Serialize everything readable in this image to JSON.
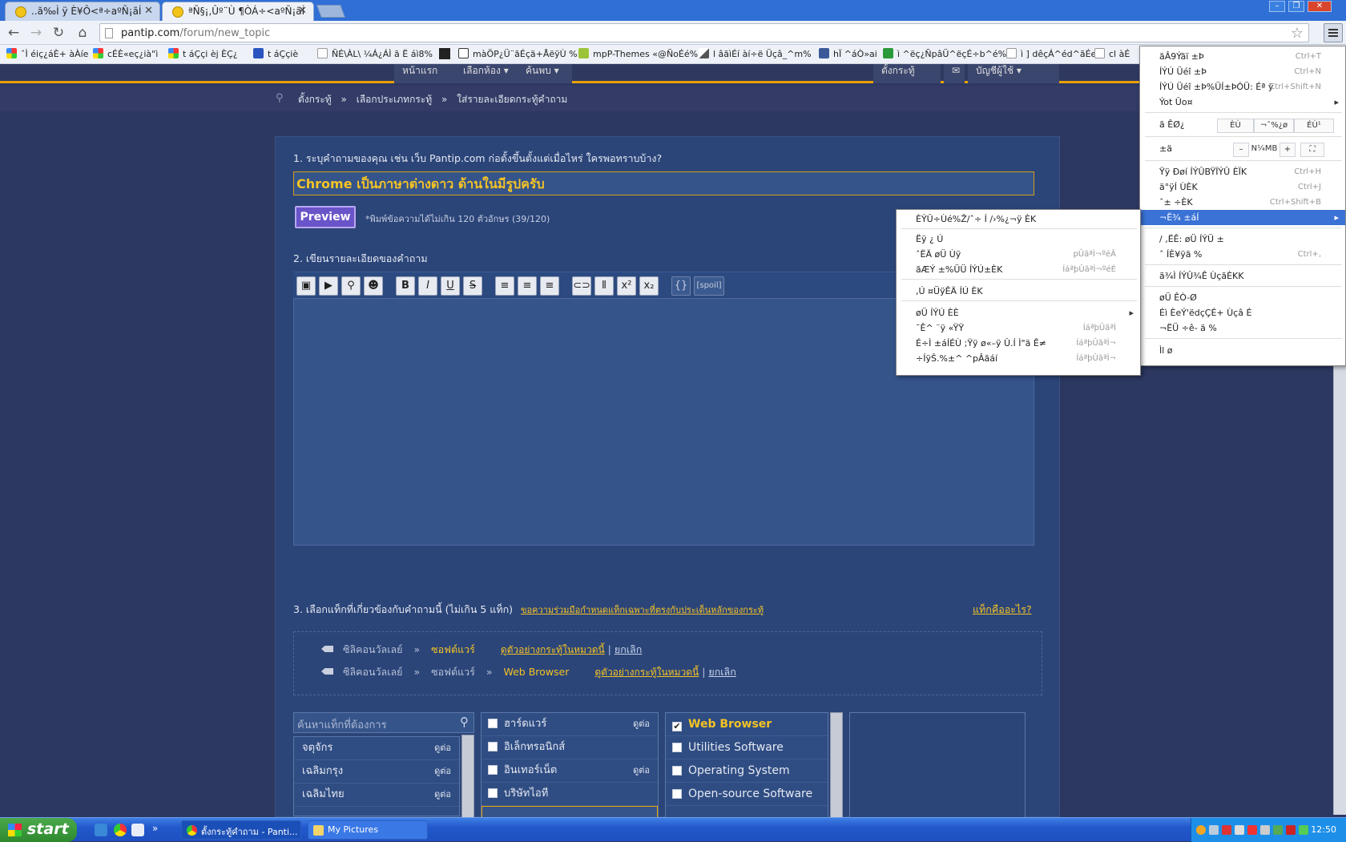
{
  "browser": {
    "tabs": [
      {
        "label": "..ã‰Ì ÿ È¥Ô<ª÷aºÑ¡ãÍ"
      },
      {
        "label": "ªÑ§¡,Ûº¨Ù ¶ÒÁ÷<aºÑ¡ãÍ"
      }
    ],
    "url_domain": "pantip.com",
    "url_path": "/forum/new_topic",
    "bookmarks": [
      "ˆÌ éiç¿áÈ+ àÀíe",
      "cÉÈ«eç¿ià\"ì",
      "t áÇçi èj ÈÇ¿",
      "t áÇçiè",
      "ÑÉ\\ÀL\\ ¼Á¿ÁÌ ã Ë áì8%",
      "màÖP¿Ü¨ãÉçä+ÅëÿÙ %",
      "mpP-Themes «@ÑoÉé%",
      "l âãìÉí àí÷ë Üçâ_^m%",
      "hÏ ^áÒ»ai",
      "ì ^ëç¿ÑpâÜ^ëçÉ÷b^é%",
      "ì ] dêçÁ^éd^ãÉe",
      "cl àÉ"
    ]
  },
  "site": {
    "nav": [
      "หน้าแรก",
      "เลือกห้อง ▾",
      "ค้นพบ ▾"
    ],
    "nav_right": [
      "ตั้งกระทู้",
      "บัญชีผู้ใช้ ▾"
    ],
    "breadcrumb": [
      "ตั้งกระทู้",
      "»",
      "เลือกประเภทกระทู้",
      "»",
      "ใส่รายละเอียดกระทู้คำถาม"
    ]
  },
  "form": {
    "q1_label": "1. ระบุคำถามของคุณ เช่น เว็บ Pantip.com ก่อตั้งขึ้นตั้งแต่เมื่อไหร่ ใครพอทราบบ้าง?",
    "title_value": "Chrome เป็นภาษาต่างดาว ด้านในมีรูปครับ",
    "preview_label": "Preview",
    "hint": "*พิมพ์ข้อความได้ไม่เกิน 120 ตัวอักษร (39/120)",
    "q2_label": "2. เขียนรายละเอียดของคำถาม",
    "toolbar": {
      "bold": "B",
      "italic": "I",
      "underline": "U",
      "strike": "S",
      "sup": "x²",
      "sub": "x₂",
      "code": "{}",
      "spoil": "[spoil]"
    },
    "q3_label": "3. เลือกแท็กที่เกี่ยวข้องกับคำถามนี้ (ไม่เกิน 5 แท็ก)",
    "q3_link": "ขอความร่วมมือกำหนดแท็กเฉพาะที่ตรงกับประเด็นหลักของกระทู้",
    "q3_help": "แท็กคืออะไร?",
    "selected_tags": [
      {
        "p1": "ซิลิคอนวัลเลย์",
        "sep": "»",
        "p2": "ซอฟต์แวร์",
        "p3": "",
        "example": "ดูตัวอย่างกระทู้ในหมวดนี้",
        "bar": "|",
        "cancel": "ยกเลิก"
      },
      {
        "p1": "ซิลิคอนวัลเลย์",
        "sep": "»",
        "p2": "ซอฟต์แวร์",
        "sep2": "»",
        "p3": "Web Browser",
        "example": "ดูตัวอย่างกระทู้ในหมวดนี้",
        "bar": "|",
        "cancel": "ยกเลิก"
      }
    ],
    "tag_search_placeholder": "ค้นหาแท็กที่ต้องการ",
    "tag_col1": [
      {
        "label": "จตุจักร",
        "more": "ดูต่อ"
      },
      {
        "label": "เฉลิมกรุง",
        "more": "ดูต่อ"
      },
      {
        "label": "เฉลิมไทย",
        "more": "ดูต่อ"
      }
    ],
    "tag_col2": [
      {
        "label": "ฮาร์ดแวร์",
        "more": "ดูต่อ"
      },
      {
        "label": "อิเล็กทรอนิกส์",
        "more": ""
      },
      {
        "label": "อินเทอร์เน็ต",
        "more": "ดูต่อ"
      },
      {
        "label": "บริษัทไอที",
        "more": ""
      }
    ],
    "tag_col3": [
      {
        "label": "Web Browser",
        "checked": true
      },
      {
        "label": "Utilities Software",
        "checked": false
      },
      {
        "label": "Operating System",
        "checked": false
      },
      {
        "label": "Open-source Software",
        "checked": false
      }
    ]
  },
  "chrome_menu": {
    "items": [
      "ãÂ9Ýãï ±Þ",
      "ÍÝÚ Üéî ±Þ",
      "ÍÝÚ Üéî ±Þ%ÜÍ±ÞÓÜ: Éª ÿ",
      "Ýot Ûo¤"
    ],
    "edit_label": "ã ÊØ¿",
    "edit_btns": [
      "ÈÙ",
      "¬ˆ%¿ø",
      "ÉÙ¹"
    ],
    "zoom_label": "±ä",
    "zoom_minus": "–",
    "zoom_value": "N¼MB",
    "zoom_plus": "+",
    "items2": [
      "Ÿÿ Ðøí ÍÝÛBŸÏÝÛ ÈÏK",
      "ä°ÿÍ ÙÈK",
      "ˆ± ÷ÈK"
    ],
    "selected": "¬Ë¾ ±áÍ",
    "items3": [
      "/ ,ËÊ: øÜ ÍÝÜ ±",
      "ˆ ÍÈ¥ÿã %"
    ],
    "items4": [
      "ã¾Ì ÍÝÛ¾Ê ÙçãÈKK"
    ],
    "items5": [
      "øÜ ÊÒ-Ø",
      "Éì ÈeÝ'ëdçÇÉ+ Ùçâ É",
      "¬ËÜ ÷ê- ä %"
    ],
    "exit": "Ìl ø",
    "shortcuts": [
      "Ctrl+T",
      "Ctrl+N",
      "Ctrl+Shift+N",
      "Ctrl+H",
      "Ctrl+J",
      "Ctrl+Shift+B",
      "Ctrl+,"
    ]
  },
  "submenu": {
    "items": [
      "ÈÝÛ÷Ùé%Ž/ˆ÷ Í /›%¿¬ÿ ÈK",
      "Ëÿ ¿ Ú",
      "ˆËÄ øÜ Ùÿ",
      "ãÆÝ ±%ÜÜ ÍÝÚ±ÈK",
      ",Ú ¤ÜÿÊÄ ÍÚ ÈK",
      "øÜ ÍÝÚ ÈÈ",
      "¯Ê^ ¨ÿ «ŸŸ",
      "É÷Ì ±áÍÉÙ ;Ÿÿ ø«–ÿ Û.Í Ì\"ä Ê≠",
      "÷ÍÿŠ.%±^ ^pÂãáí"
    ],
    "shortcuts": [
      "pÛãªÌ¬ºéÂ",
      "ÍáªþÛãªÌ¬ºéÉ",
      "ÍáªþÛãªÌ",
      "ÍáªþÛãªÌ¬"
    ]
  },
  "taskbar": {
    "start": "start",
    "tasks": [
      "ตั้งกระทู้คำถาม - Panti...",
      "My Pictures"
    ],
    "clock": "12:50"
  }
}
